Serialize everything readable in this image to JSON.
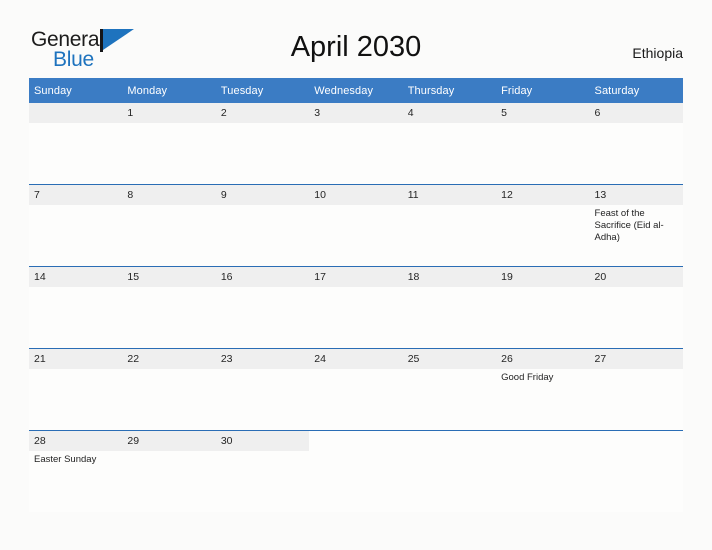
{
  "brand": {
    "name_top": "General",
    "name_bottom": "Blue",
    "logo_icon": "blue-triangle-logo",
    "color_blue": "#1e73be"
  },
  "header": {
    "title": "April 2030",
    "country": "Ethiopia",
    "header_bg": "#3b7cc4",
    "row_rule": "#2a6db5",
    "daynum_bg": "#efefef"
  },
  "weekday_headers": [
    "Sunday",
    "Monday",
    "Tuesday",
    "Wednesday",
    "Thursday",
    "Friday",
    "Saturday"
  ],
  "weeks": [
    {
      "days": [
        {
          "date": "",
          "event": "",
          "blank": true
        },
        {
          "date": "1",
          "event": ""
        },
        {
          "date": "2",
          "event": ""
        },
        {
          "date": "3",
          "event": ""
        },
        {
          "date": "4",
          "event": ""
        },
        {
          "date": "5",
          "event": ""
        },
        {
          "date": "6",
          "event": ""
        }
      ]
    },
    {
      "days": [
        {
          "date": "7",
          "event": ""
        },
        {
          "date": "8",
          "event": ""
        },
        {
          "date": "9",
          "event": ""
        },
        {
          "date": "10",
          "event": ""
        },
        {
          "date": "11",
          "event": ""
        },
        {
          "date": "12",
          "event": ""
        },
        {
          "date": "13",
          "event": "Feast of the Sacrifice (Eid al-Adha)"
        }
      ]
    },
    {
      "days": [
        {
          "date": "14",
          "event": ""
        },
        {
          "date": "15",
          "event": ""
        },
        {
          "date": "16",
          "event": ""
        },
        {
          "date": "17",
          "event": ""
        },
        {
          "date": "18",
          "event": ""
        },
        {
          "date": "19",
          "event": ""
        },
        {
          "date": "20",
          "event": ""
        }
      ]
    },
    {
      "days": [
        {
          "date": "21",
          "event": ""
        },
        {
          "date": "22",
          "event": ""
        },
        {
          "date": "23",
          "event": ""
        },
        {
          "date": "24",
          "event": ""
        },
        {
          "date": "25",
          "event": ""
        },
        {
          "date": "26",
          "event": "Good Friday"
        },
        {
          "date": "27",
          "event": ""
        }
      ]
    },
    {
      "days": [
        {
          "date": "28",
          "event": "Easter Sunday"
        },
        {
          "date": "29",
          "event": ""
        },
        {
          "date": "30",
          "event": ""
        },
        {
          "date": "",
          "event": "",
          "void": true
        },
        {
          "date": "",
          "event": "",
          "void": true
        },
        {
          "date": "",
          "event": "",
          "void": true
        },
        {
          "date": "",
          "event": "",
          "void": true
        }
      ]
    }
  ]
}
